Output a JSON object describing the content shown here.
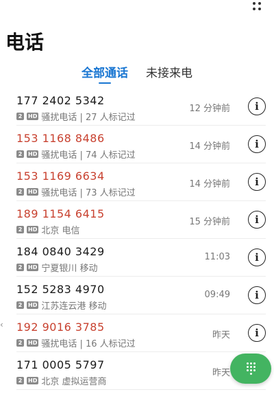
{
  "header": {
    "title": "电话"
  },
  "tabs": [
    {
      "label": "全部通话",
      "active": true
    },
    {
      "label": "未接来电",
      "active": false
    }
  ],
  "calls": [
    {
      "number": "177 2402 5342",
      "missed": false,
      "sim": "2",
      "hd": "HD",
      "desc": "骚扰电话 | 27 人标记过",
      "time": "12 分钟前"
    },
    {
      "number": "153 1168 8486",
      "missed": true,
      "sim": "2",
      "hd": "HD",
      "desc": "骚扰电话 | 74 人标记过",
      "time": "14 分钟前"
    },
    {
      "number": "153 1169 6634",
      "missed": true,
      "sim": "2",
      "hd": "HD",
      "desc": "骚扰电话 | 73 人标记过",
      "time": "14 分钟前"
    },
    {
      "number": "189 1154 6415",
      "missed": true,
      "sim": "2",
      "hd": "HD",
      "desc": "北京 电信",
      "time": "15 分钟前"
    },
    {
      "number": "184 0840 3429",
      "missed": false,
      "sim": "2",
      "hd": "HD",
      "desc": "宁夏银川 移动",
      "time": "11:03"
    },
    {
      "number": "152 5283 4970",
      "missed": false,
      "sim": "2",
      "hd": "HD",
      "desc": "江苏连云港 移动",
      "time": "09:49"
    },
    {
      "number": "192 9016 3785",
      "missed": true,
      "sim": "2",
      "hd": "HD",
      "desc": "骚扰电话 | 16 人标记过",
      "time": "昨天"
    },
    {
      "number": "171 0005 5797",
      "missed": false,
      "sim": "2",
      "hd": "HD",
      "desc": "北京 虚拟运营商",
      "time": "昨天"
    }
  ],
  "icons": {
    "more": "more-vert-icon",
    "info": "info-icon",
    "dialpad": "dialpad-icon"
  },
  "colors": {
    "accent": "#1976d2",
    "missed": "#c8412f",
    "fab": "#43b461"
  }
}
